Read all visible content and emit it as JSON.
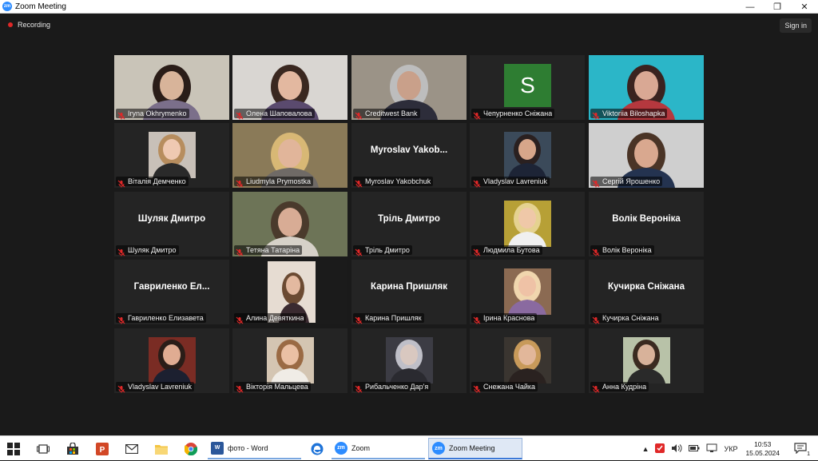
{
  "window": {
    "title": "Zoom Meeting",
    "logo_text": "zm",
    "minimize": "—",
    "maximize": "❐",
    "close": "✕"
  },
  "meeting": {
    "recording_label": "Recording",
    "signin_label": "Sign in"
  },
  "tiles": [
    {
      "name": "Iryna Okhrymenko",
      "kind": "video",
      "bg": "#c9c4b8",
      "skin": "#d8b49a",
      "hair": "#2a1d18",
      "shirt": "#7b6f8a"
    },
    {
      "name": "Олена Шаповалова",
      "kind": "video",
      "bg": "#d9d6d2",
      "skin": "#e3b8a0",
      "hair": "#3a2820",
      "shirt": "#5a4a6e"
    },
    {
      "name": "Creditwest Bank",
      "kind": "video",
      "bg": "#9b9387",
      "skin": "#c9a08a",
      "hair": "#bdbdbd",
      "shirt": "#2d2d3a"
    },
    {
      "name": "Чепурненко Сніжана",
      "kind": "initial",
      "initial": "S"
    },
    {
      "name": "Viktoriia Biloshapka",
      "kind": "video",
      "bg": "#2bb6c8",
      "skin": "#d9a894",
      "hair": "#3a2320",
      "shirt": "#b5383e"
    },
    {
      "name": "Віталія Демченко",
      "kind": "photo",
      "bg": "#c8c0b8",
      "skin": "#efc9b2",
      "hair": "#b78d5e",
      "shirt": "#2a2a2a"
    },
    {
      "name": "Liudmyla Prymostka",
      "kind": "video",
      "bg": "#8a7a58",
      "skin": "#e1b59a",
      "hair": "#d8b875",
      "shirt": "#6f6a66"
    },
    {
      "name": "Myroslav Yakobchuk",
      "kind": "text",
      "big": "Myroslav  Yakob..."
    },
    {
      "name": "Vladyslav Lavreniuk",
      "kind": "photo",
      "bg": "#3b4a5a",
      "skin": "#d7a68a",
      "hair": "#2a2020",
      "shirt": "#1d2436"
    },
    {
      "name": "Сергій Ярошенко",
      "kind": "video",
      "bg": "#cfcfcf",
      "skin": "#d9a88f",
      "hair": "#4a3426",
      "shirt": "#243350"
    },
    {
      "name": "Шуляк Дмитро",
      "kind": "text",
      "big": "Шуляк Дмитро"
    },
    {
      "name": "Тетяна Татаріна",
      "kind": "video",
      "bg": "#6d7457",
      "skin": "#d8ac95",
      "hair": "#4a3a2c",
      "shirt": "#d6d1c8"
    },
    {
      "name": "Тріль Дмитро",
      "kind": "text",
      "big": "Тріль Дмитро"
    },
    {
      "name": "Людмила Бутова",
      "kind": "photo",
      "bg": "#b7a036",
      "skin": "#efc8a8",
      "hair": "#e5d290",
      "shirt": "#f0f0f0"
    },
    {
      "name": "Волік Вероніка",
      "kind": "text",
      "big": "Волік Вероніка"
    },
    {
      "name": "Гавриленко Елизавета",
      "kind": "text",
      "big": "Гавриленко  Ел..."
    },
    {
      "name": "Алина Девяткина",
      "kind": "phone",
      "bg": "#e6dcd2",
      "skin": "#e3b9a0",
      "hair": "#6b4a32",
      "shirt": "#3a2a30"
    },
    {
      "name": "Карина Пришляк",
      "kind": "text",
      "big": "Карина Пришляк"
    },
    {
      "name": "Ірина Краснова",
      "kind": "photo",
      "bg": "#8b6a52",
      "skin": "#efc2a6",
      "hair": "#f0d6ae",
      "shirt": "#8a6aa0"
    },
    {
      "name": "Кучирка Сніжана",
      "kind": "text",
      "big": "Кучирка Сніжана"
    },
    {
      "name": "Vladyslav Lavreniuk",
      "kind": "photo",
      "bg": "#7a2c24",
      "skin": "#e0ac92",
      "hair": "#2a1d18",
      "shirt": "#1c2030"
    },
    {
      "name": "Вікторія Мальцева",
      "kind": "photo",
      "bg": "#d4c5b2",
      "skin": "#eac0a4",
      "hair": "#9a6a44",
      "shirt": "#f0ece6"
    },
    {
      "name": "Рибальченко Дар'я",
      "kind": "photo",
      "bg": "#3c3c44",
      "skin": "#d9c8c0",
      "hair": "#bfbfc8",
      "shirt": "#2a2a30"
    },
    {
      "name": "Снежана Чайка",
      "kind": "photo",
      "bg": "#3a3530",
      "skin": "#e2b79a",
      "hair": "#c89a5a",
      "shirt": "#2a2220"
    },
    {
      "name": "Анна Кудріна",
      "kind": "photo",
      "bg": "#b8c2a8",
      "skin": "#d8b29a",
      "hair": "#3a2a20",
      "shirt": "#2a2a2a"
    }
  ],
  "taskbar": {
    "tasks": [
      {
        "label": "фото - Word",
        "icon_text": "W",
        "icon_color": "#2b579a"
      },
      {
        "label": "Zoom",
        "icon_text": "zm",
        "icon_color": "#2D8CFF"
      },
      {
        "label": "Zoom Meeting",
        "icon_text": "zm",
        "icon_color": "#2D8CFF"
      }
    ],
    "language": "УКР",
    "time": "10:53",
    "date": "15.05.2024",
    "notification_count": "1"
  },
  "colors": {
    "accent": "#2D8CFF",
    "active_speaker": "#e8f54b",
    "muted_red": "#e02828"
  }
}
